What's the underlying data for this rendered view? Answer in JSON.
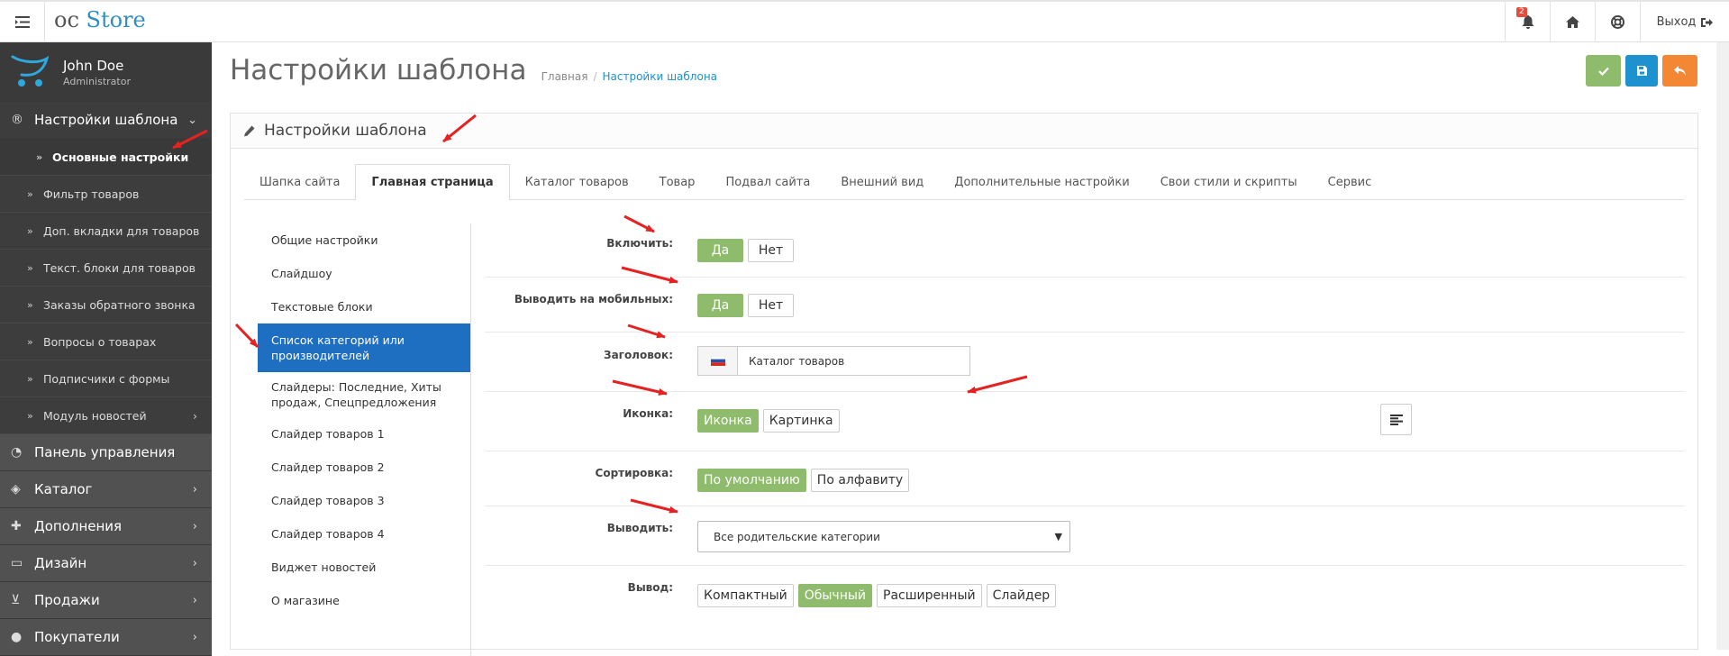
{
  "header": {
    "logo_prefix": "oc",
    "logo_name": "Store",
    "notification_count": "2",
    "logout_label": "Выход"
  },
  "profile": {
    "name": "John Doe",
    "role": "Administrator"
  },
  "sidebar": {
    "items": [
      {
        "label": "Настройки шаблона"
      },
      {
        "label": "Основные настройки"
      },
      {
        "label": "Фильтр товаров"
      },
      {
        "label": "Доп. вкладки для товаров"
      },
      {
        "label": "Текст. блоки для товаров"
      },
      {
        "label": "Заказы обратного звонка"
      },
      {
        "label": "Вопросы о товарах"
      },
      {
        "label": "Подписчики с формы"
      },
      {
        "label": "Модуль новостей"
      },
      {
        "label": "Панель управления"
      },
      {
        "label": "Каталог"
      },
      {
        "label": "Дополнения"
      },
      {
        "label": "Дизайн"
      },
      {
        "label": "Продажи"
      },
      {
        "label": "Покупатели"
      }
    ]
  },
  "page": {
    "title": "Настройки шаблона",
    "breadcrumb_home": "Главная",
    "breadcrumb_sep": "/",
    "breadcrumb_current": "Настройки шаблона",
    "panel_title": "Настройки шаблона"
  },
  "tabs": [
    "Шапка сайта",
    "Главная страница",
    "Каталог товаров",
    "Товар",
    "Подвал сайта",
    "Внешний вид",
    "Дополнительные настройки",
    "Свои стили и скрипты",
    "Сервис"
  ],
  "left_list": [
    "Общие настройки",
    "Слайдшоу",
    "Текстовые блоки",
    "Список категорий или производителей",
    "Слайдеры: Последние, Хиты продаж, Спецпредложения",
    "Слайдер товаров 1",
    "Слайдер товаров 2",
    "Слайдер товаров 3",
    "Слайдер товаров 4",
    "Виджет новостей",
    "О магазине"
  ],
  "form": {
    "enable": {
      "label": "Включить:",
      "yes": "Да",
      "no": "Нет",
      "value": "Да"
    },
    "mobile": {
      "label": "Выводить на мобильных:",
      "yes": "Да",
      "no": "Нет",
      "value": "Да"
    },
    "heading": {
      "label": "Заголовок:",
      "value": "Каталог товаров"
    },
    "icon": {
      "label": "Иконка:",
      "opt1": "Иконка",
      "opt2": "Картинка",
      "value": "Иконка"
    },
    "sort": {
      "label": "Сортировка:",
      "opt1": "По умолчанию",
      "opt2": "По алфавиту",
      "value": "По умолчанию"
    },
    "show": {
      "label": "Выводить:",
      "value": "Все родительские категории"
    },
    "view": {
      "label": "Вывод:",
      "opt1": "Компактный",
      "opt2": "Обычный",
      "opt3": "Расширенный",
      "opt4": "Слайдер",
      "value": "Обычный"
    }
  },
  "colors": {
    "accent_green": "#8fbb6c",
    "accent_blue": "#1e91cf",
    "accent_orange": "#f38733",
    "active_blue": "#1e6fc2",
    "sidebar": "#444444",
    "annotation_red": "#e52222"
  }
}
